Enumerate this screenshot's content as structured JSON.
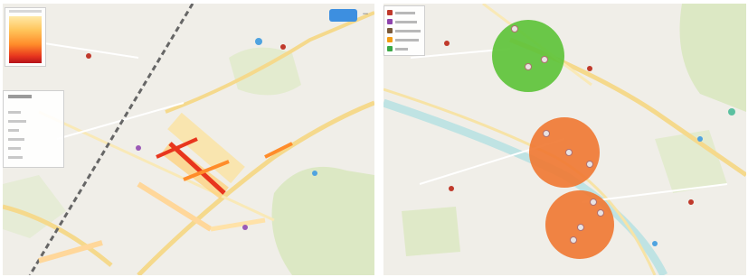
{
  "left_map": {
    "heat_legend": {
      "colors": [
        "#ffe9a8",
        "#ffc45a",
        "#ff8c2a",
        "#e8361e",
        "#b5121b"
      ]
    },
    "layer_list": {
      "rows": 7
    },
    "button": {
      "color": "#3d8fe0"
    },
    "zoom_icon": "zoom-out-icon"
  },
  "right_map": {
    "legend": {
      "colors": [
        "#c0392b",
        "#8e44ad",
        "#7a5a3a",
        "#f39c12",
        "#3aa845"
      ]
    },
    "clusters": [
      {
        "color": "#5ec33a",
        "markers": 3
      },
      {
        "color": "#f07a34",
        "markers": 3
      },
      {
        "color": "#f07a34",
        "markers": 4
      }
    ]
  },
  "colors": {
    "land": "#f0eee8",
    "road": "#f7e3a6",
    "river": "#bfe3e3",
    "park": "#dce8c4",
    "railway": "#666666"
  }
}
